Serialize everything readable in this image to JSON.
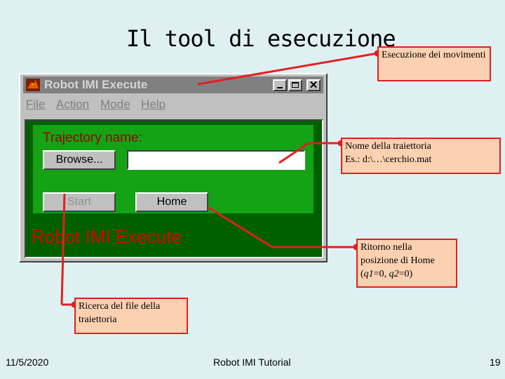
{
  "slide": {
    "title": "Il tool di esecuzione",
    "footer_date": "11/5/2020",
    "footer_center": "Robot IMI Tutorial",
    "page_number": "19"
  },
  "window": {
    "title": "Robot IMI Execute",
    "minimize_glyph": "_",
    "close_glyph": "✕",
    "menu": [
      "File",
      "Action",
      "Mode",
      "Help"
    ],
    "trajectory_label": "Trajectory name:",
    "browse_label": "Browse...",
    "trajectory_value": "",
    "start_label": "Start",
    "home_label": "Home",
    "big_name": "Robot IMI Execute",
    "colors": {
      "panel_bg": "#006000",
      "inner_bg": "#14a314",
      "label_red": "#a00000",
      "name_red": "#e00000"
    },
    "icon": "matlab-logo-icon"
  },
  "callouts": {
    "execution": "Esecuzione dei movimenti",
    "trajectory_line1": "Nome della traiettoria",
    "trajectory_line2": "Es.: d:\\…\\cerchio.mat",
    "home_line1": "Ritorno nella",
    "home_line2": "posizione di Home",
    "home_q1": "q1",
    "home_eq1": "=0, ",
    "home_q2": "q2",
    "home_eq2": "=0)",
    "home_open": "(",
    "search": "Ricerca del file della traiettoria"
  },
  "colors": {
    "background": "#dff0f2",
    "callout_fill": "#fbd1b1",
    "callout_border": "#e02020"
  }
}
